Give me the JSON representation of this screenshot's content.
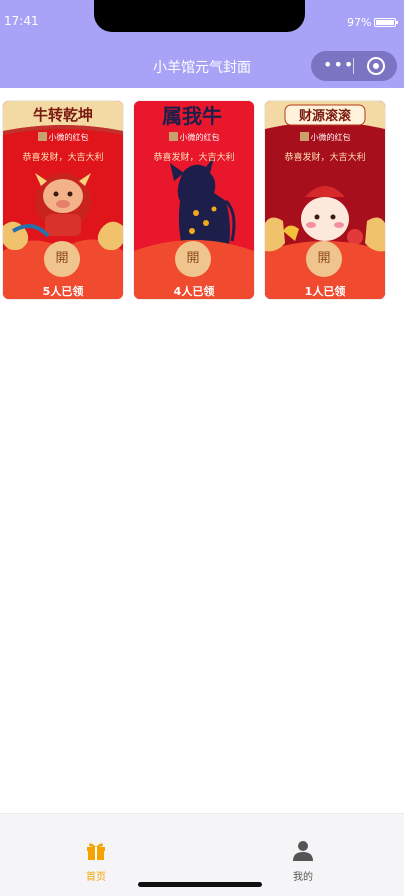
{
  "status": {
    "time": "17:41",
    "battery": "97%"
  },
  "nav": {
    "title": "小羊馆元气封面"
  },
  "cards": [
    {
      "top_text": "牛转乾坤",
      "sender": "小微的红包",
      "blessing": "恭喜发财，大吉大利",
      "open_label": "開",
      "claimed": "5人已领"
    },
    {
      "top_text": "属我牛",
      "sender": "小微的红包",
      "blessing": "恭喜发财，大吉大利",
      "open_label": "開",
      "claimed": "4人已领"
    },
    {
      "top_text": "财源滚滚",
      "sender": "小微的红包",
      "blessing": "恭喜发财，大吉大利",
      "open_label": "開",
      "claimed": "1人已领"
    }
  ],
  "tabbar": {
    "home": {
      "label": "首页",
      "icon": "gift-icon",
      "color": "#f5a300"
    },
    "mine": {
      "label": "我的",
      "icon": "user-icon",
      "color": "#555555"
    }
  },
  "colors": {
    "header": "#a9a3f7",
    "card_red": "#d9161f"
  }
}
